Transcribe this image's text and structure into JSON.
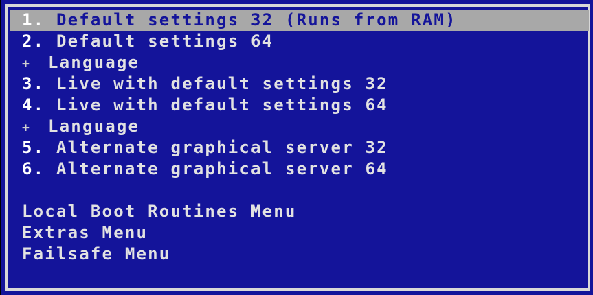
{
  "menu": {
    "items": [
      {
        "num": "1.",
        "label": " Default settings 32 (Runs from RAM)",
        "selected": true
      },
      {
        "num": "2.",
        "label": " Default settings 64"
      },
      {
        "plus": "+",
        "label": "Language"
      },
      {
        "num": "3.",
        "label": " Live with default settings 32"
      },
      {
        "num": "4.",
        "label": " Live with default settings 64"
      },
      {
        "plus": "+",
        "label": "Language"
      },
      {
        "num": "5.",
        "label": " Alternate graphical server 32"
      },
      {
        "num": "6.",
        "label": " Alternate graphical server 64"
      }
    ],
    "extra_items": [
      {
        "label": "Local Boot Routines Menu"
      },
      {
        "label": "Extras Menu"
      },
      {
        "label": "Failsafe Menu"
      }
    ]
  },
  "colors": {
    "background": "#14149a",
    "highlight": "#a8a8a8",
    "text": "#e2e2e2"
  }
}
